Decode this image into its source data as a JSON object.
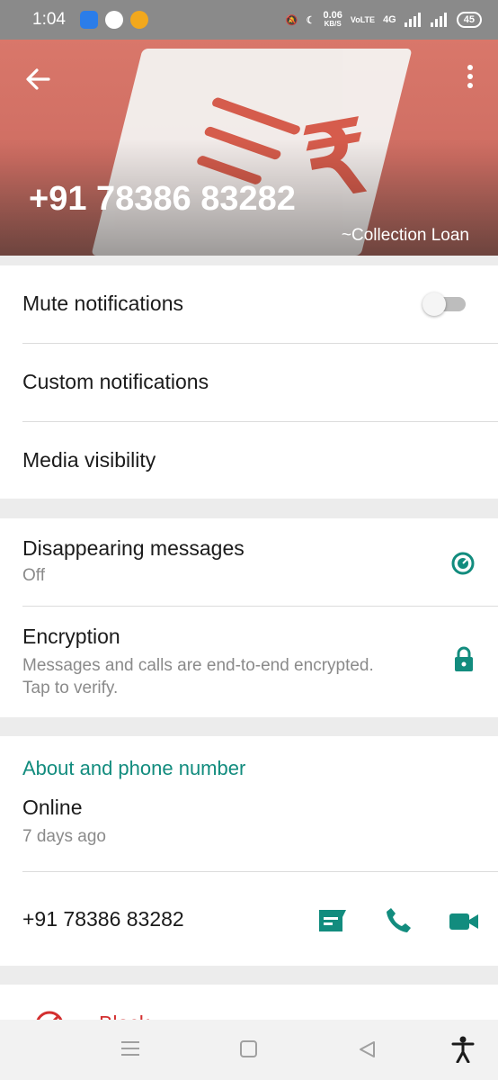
{
  "status_bar": {
    "time": "1:04",
    "speed_value": "0.06",
    "speed_unit": "KB/S",
    "volte": "VoLTE",
    "network": "4G",
    "battery": "45"
  },
  "header": {
    "title": "+91 78386 83282",
    "subtitle": "~Collection Loan"
  },
  "settings": {
    "mute": "Mute notifications",
    "custom": "Custom notifications",
    "media": "Media visibility"
  },
  "privacy": {
    "disappearing": "Disappearing messages",
    "disappearing_status": "Off",
    "encryption": "Encryption",
    "encryption_line1": "Messages and calls are end-to-end encrypted.",
    "encryption_line2": "Tap to verify."
  },
  "about": {
    "section_title": "About and phone number",
    "status": "Online",
    "status_date": "7 days ago",
    "phone": "+91 78386 83282"
  },
  "block": {
    "label": "Block"
  },
  "colors": {
    "accent": "#128c7e",
    "danger": "#d32f2f"
  },
  "mute_enabled": false
}
